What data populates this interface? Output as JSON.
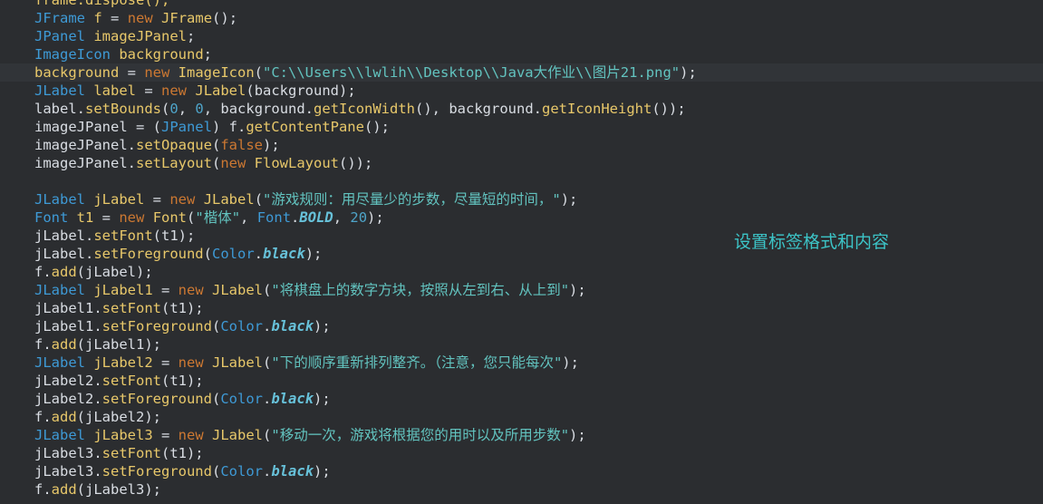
{
  "annotation": "设置标签格式和内容",
  "lines": [
    [
      {
        "t": "frame.dispose();",
        "c": "fn"
      }
    ],
    [
      {
        "t": "JFrame",
        "c": "cls"
      },
      {
        "t": " ",
        "c": "pl"
      },
      {
        "t": "f",
        "c": "var"
      },
      {
        "t": " = ",
        "c": "pl"
      },
      {
        "t": "new",
        "c": "kw"
      },
      {
        "t": " ",
        "c": "pl"
      },
      {
        "t": "JFrame",
        "c": "fn"
      },
      {
        "t": "();",
        "c": "pl"
      }
    ],
    [
      {
        "t": "JPanel",
        "c": "cls"
      },
      {
        "t": " ",
        "c": "pl"
      },
      {
        "t": "imageJPanel",
        "c": "var"
      },
      {
        "t": ";",
        "c": "pl"
      }
    ],
    [
      {
        "t": "ImageIcon",
        "c": "cls"
      },
      {
        "t": " ",
        "c": "pl"
      },
      {
        "t": "background",
        "c": "var"
      },
      {
        "t": ";",
        "c": "pl"
      }
    ],
    [
      {
        "t": "background",
        "c": "fn"
      },
      {
        "t": " = ",
        "c": "pl"
      },
      {
        "t": "new",
        "c": "kw"
      },
      {
        "t": " ",
        "c": "pl"
      },
      {
        "t": "ImageIcon",
        "c": "fn"
      },
      {
        "t": "(",
        "c": "pl"
      },
      {
        "t": "\"C:\\\\Users\\\\lwlih\\\\Desktop\\\\Java大作业\\\\图片21.png\"",
        "c": "str"
      },
      {
        "t": ");",
        "c": "pl"
      }
    ],
    [
      {
        "t": "JLabel",
        "c": "cls"
      },
      {
        "t": " ",
        "c": "pl"
      },
      {
        "t": "label",
        "c": "var"
      },
      {
        "t": " = ",
        "c": "pl"
      },
      {
        "t": "new",
        "c": "kw"
      },
      {
        "t": " ",
        "c": "pl"
      },
      {
        "t": "JLabel",
        "c": "fn"
      },
      {
        "t": "(background);",
        "c": "pl"
      }
    ],
    [
      {
        "t": "label.",
        "c": "pl"
      },
      {
        "t": "setBounds",
        "c": "fn"
      },
      {
        "t": "(",
        "c": "pl"
      },
      {
        "t": "0",
        "c": "num"
      },
      {
        "t": ", ",
        "c": "pl"
      },
      {
        "t": "0",
        "c": "num"
      },
      {
        "t": ", background.",
        "c": "pl"
      },
      {
        "t": "getIconWidth",
        "c": "fn"
      },
      {
        "t": "(), background.",
        "c": "pl"
      },
      {
        "t": "getIconHeight",
        "c": "fn"
      },
      {
        "t": "());",
        "c": "pl"
      }
    ],
    [
      {
        "t": "imageJPanel = (",
        "c": "pl"
      },
      {
        "t": "JPanel",
        "c": "cls"
      },
      {
        "t": ") f.",
        "c": "pl"
      },
      {
        "t": "getContentPane",
        "c": "fn"
      },
      {
        "t": "();",
        "c": "pl"
      }
    ],
    [
      {
        "t": "imageJPanel.",
        "c": "pl"
      },
      {
        "t": "setOpaque",
        "c": "fn"
      },
      {
        "t": "(",
        "c": "pl"
      },
      {
        "t": "false",
        "c": "kw"
      },
      {
        "t": ");",
        "c": "pl"
      }
    ],
    [
      {
        "t": "imageJPanel.",
        "c": "pl"
      },
      {
        "t": "setLayout",
        "c": "fn"
      },
      {
        "t": "(",
        "c": "pl"
      },
      {
        "t": "new",
        "c": "kw"
      },
      {
        "t": " ",
        "c": "pl"
      },
      {
        "t": "FlowLayout",
        "c": "fn"
      },
      {
        "t": "());",
        "c": "pl"
      }
    ],
    [],
    [
      {
        "t": "JLabel",
        "c": "cls"
      },
      {
        "t": " ",
        "c": "pl"
      },
      {
        "t": "jLabel",
        "c": "var"
      },
      {
        "t": " = ",
        "c": "pl"
      },
      {
        "t": "new",
        "c": "kw"
      },
      {
        "t": " ",
        "c": "pl"
      },
      {
        "t": "JLabel",
        "c": "fn"
      },
      {
        "t": "(",
        "c": "pl"
      },
      {
        "t": "\"游戏规则：用尽量少的步数，尽量短的时间，\"",
        "c": "str"
      },
      {
        "t": ");",
        "c": "pl"
      }
    ],
    [
      {
        "t": "Font",
        "c": "cls"
      },
      {
        "t": " ",
        "c": "pl"
      },
      {
        "t": "t1",
        "c": "var"
      },
      {
        "t": " = ",
        "c": "pl"
      },
      {
        "t": "new",
        "c": "kw"
      },
      {
        "t": " ",
        "c": "pl"
      },
      {
        "t": "Font",
        "c": "fn"
      },
      {
        "t": "(",
        "c": "pl"
      },
      {
        "t": "\"楷体\"",
        "c": "str"
      },
      {
        "t": ", ",
        "c": "pl"
      },
      {
        "t": "Font",
        "c": "cls"
      },
      {
        "t": ".",
        "c": "pl"
      },
      {
        "t": "BOLD",
        "c": "const"
      },
      {
        "t": ", ",
        "c": "pl"
      },
      {
        "t": "20",
        "c": "num"
      },
      {
        "t": ");",
        "c": "pl"
      }
    ],
    [
      {
        "t": "jLabel.",
        "c": "pl"
      },
      {
        "t": "setFont",
        "c": "fn"
      },
      {
        "t": "(t1);",
        "c": "pl"
      }
    ],
    [
      {
        "t": "jLabel.",
        "c": "pl"
      },
      {
        "t": "setForeground",
        "c": "fn"
      },
      {
        "t": "(",
        "c": "pl"
      },
      {
        "t": "Color",
        "c": "cls"
      },
      {
        "t": ".",
        "c": "pl"
      },
      {
        "t": "black",
        "c": "const"
      },
      {
        "t": ");",
        "c": "pl"
      }
    ],
    [
      {
        "t": "f.",
        "c": "pl"
      },
      {
        "t": "add",
        "c": "fn"
      },
      {
        "t": "(jLabel);",
        "c": "pl"
      }
    ],
    [
      {
        "t": "JLabel",
        "c": "cls"
      },
      {
        "t": " ",
        "c": "pl"
      },
      {
        "t": "jLabel1",
        "c": "var"
      },
      {
        "t": " = ",
        "c": "pl"
      },
      {
        "t": "new",
        "c": "kw"
      },
      {
        "t": " ",
        "c": "pl"
      },
      {
        "t": "JLabel",
        "c": "fn"
      },
      {
        "t": "(",
        "c": "pl"
      },
      {
        "t": "\"将棋盘上的数字方块，按照从左到右、从上到\"",
        "c": "str"
      },
      {
        "t": ");",
        "c": "pl"
      }
    ],
    [
      {
        "t": "jLabel1.",
        "c": "pl"
      },
      {
        "t": "setFont",
        "c": "fn"
      },
      {
        "t": "(t1);",
        "c": "pl"
      }
    ],
    [
      {
        "t": "jLabel1.",
        "c": "pl"
      },
      {
        "t": "setForeground",
        "c": "fn"
      },
      {
        "t": "(",
        "c": "pl"
      },
      {
        "t": "Color",
        "c": "cls"
      },
      {
        "t": ".",
        "c": "pl"
      },
      {
        "t": "black",
        "c": "const"
      },
      {
        "t": ");",
        "c": "pl"
      }
    ],
    [
      {
        "t": "f.",
        "c": "pl"
      },
      {
        "t": "add",
        "c": "fn"
      },
      {
        "t": "(jLabel1);",
        "c": "pl"
      }
    ],
    [
      {
        "t": "JLabel",
        "c": "cls"
      },
      {
        "t": " ",
        "c": "pl"
      },
      {
        "t": "jLabel2",
        "c": "var"
      },
      {
        "t": " = ",
        "c": "pl"
      },
      {
        "t": "new",
        "c": "kw"
      },
      {
        "t": " ",
        "c": "pl"
      },
      {
        "t": "JLabel",
        "c": "fn"
      },
      {
        "t": "(",
        "c": "pl"
      },
      {
        "t": "\"下的顺序重新排列整齐。（注意，您只能每次\"",
        "c": "str"
      },
      {
        "t": ");",
        "c": "pl"
      }
    ],
    [
      {
        "t": "jLabel2.",
        "c": "pl"
      },
      {
        "t": "setFont",
        "c": "fn"
      },
      {
        "t": "(t1);",
        "c": "pl"
      }
    ],
    [
      {
        "t": "jLabel2.",
        "c": "pl"
      },
      {
        "t": "setForeground",
        "c": "fn"
      },
      {
        "t": "(",
        "c": "pl"
      },
      {
        "t": "Color",
        "c": "cls"
      },
      {
        "t": ".",
        "c": "pl"
      },
      {
        "t": "black",
        "c": "const"
      },
      {
        "t": ");",
        "c": "pl"
      }
    ],
    [
      {
        "t": "f.",
        "c": "pl"
      },
      {
        "t": "add",
        "c": "fn"
      },
      {
        "t": "(jLabel2);",
        "c": "pl"
      }
    ],
    [
      {
        "t": "JLabel",
        "c": "cls"
      },
      {
        "t": " ",
        "c": "pl"
      },
      {
        "t": "jLabel3",
        "c": "var"
      },
      {
        "t": " = ",
        "c": "pl"
      },
      {
        "t": "new",
        "c": "kw"
      },
      {
        "t": " ",
        "c": "pl"
      },
      {
        "t": "JLabel",
        "c": "fn"
      },
      {
        "t": "(",
        "c": "pl"
      },
      {
        "t": "\"移动一次，游戏将根据您的用时以及所用步数\"",
        "c": "str"
      },
      {
        "t": ");",
        "c": "pl"
      }
    ],
    [
      {
        "t": "jLabel3.",
        "c": "pl"
      },
      {
        "t": "setFont",
        "c": "fn"
      },
      {
        "t": "(t1);",
        "c": "pl"
      }
    ],
    [
      {
        "t": "jLabel3.",
        "c": "pl"
      },
      {
        "t": "setForeground",
        "c": "fn"
      },
      {
        "t": "(",
        "c": "pl"
      },
      {
        "t": "Color",
        "c": "cls"
      },
      {
        "t": ".",
        "c": "pl"
      },
      {
        "t": "black",
        "c": "const"
      },
      {
        "t": ");",
        "c": "pl"
      }
    ],
    [
      {
        "t": "f.",
        "c": "pl"
      },
      {
        "t": "add",
        "c": "fn"
      },
      {
        "t": "(jLabel3);",
        "c": "pl"
      }
    ]
  ],
  "highlighted_line": 4
}
